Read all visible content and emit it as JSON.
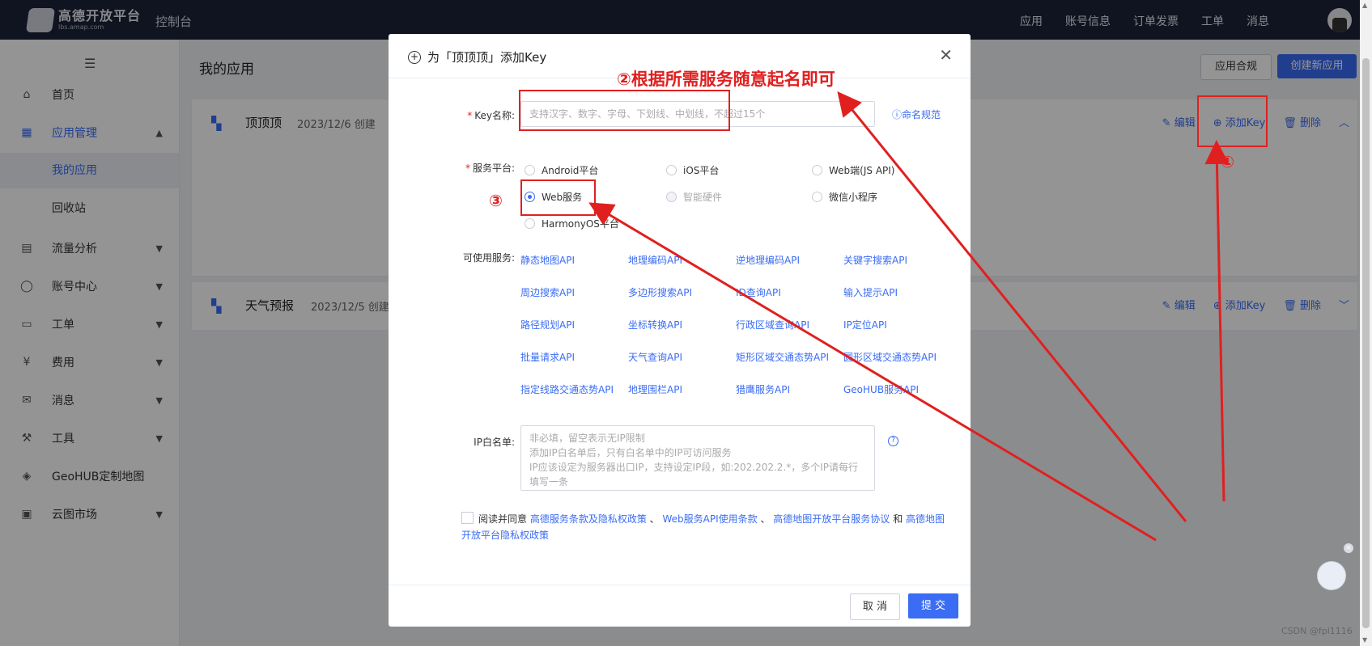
{
  "topbar": {
    "logo_main": "高德开放平台",
    "logo_sub": "lbs.amap.com",
    "console": "控制台",
    "nav": [
      "应用",
      "账号信息",
      "订单发票",
      "工单",
      "消息"
    ]
  },
  "sidebar": {
    "items": [
      {
        "label": "首页",
        "icon": "home-icon"
      },
      {
        "label": "应用管理",
        "icon": "grid-icon"
      },
      {
        "label": "我的应用"
      },
      {
        "label": "回收站"
      },
      {
        "label": "流量分析",
        "icon": "chart-icon"
      },
      {
        "label": "账号中心",
        "icon": "user-icon"
      },
      {
        "label": "工单",
        "icon": "ticket-icon"
      },
      {
        "label": "费用",
        "icon": "money-icon"
      },
      {
        "label": "消息",
        "icon": "message-icon"
      },
      {
        "label": "工具",
        "icon": "wrench-icon"
      },
      {
        "label": "GeoHUB定制地图",
        "icon": "layers-icon"
      },
      {
        "label": "云图市场",
        "icon": "store-icon"
      }
    ]
  },
  "main": {
    "title": "我的应用",
    "compliance_btn": "应用合规",
    "create_btn": "创建新应用",
    "apps": [
      {
        "name": "顶顶顶",
        "date": "2023/12/6 创建"
      },
      {
        "name": "天气预报",
        "date": "2023/12/5 创建"
      }
    ],
    "actions": {
      "edit": "编辑",
      "add_key": "添加Key",
      "delete": "删除"
    }
  },
  "modal": {
    "title": "为「顶顶顶」添加Key",
    "key_label": "Key名称:",
    "key_placeholder": "支持汉字、数字、字母、下划线、中划线，不超过15个",
    "name_rule": "命名规范",
    "platform_label": "服务平台:",
    "platforms": [
      {
        "label": "Android平台",
        "checked": false,
        "disabled": false
      },
      {
        "label": "iOS平台",
        "checked": false,
        "disabled": false
      },
      {
        "label": "Web端(JS API)",
        "checked": false,
        "disabled": false
      },
      {
        "label": "Web服务",
        "checked": true,
        "disabled": false
      },
      {
        "label": "智能硬件",
        "checked": false,
        "disabled": true
      },
      {
        "label": "微信小程序",
        "checked": false,
        "disabled": false
      },
      {
        "label": "HarmonyOS平台",
        "checked": false,
        "disabled": false
      }
    ],
    "services_label": "可使用服务:",
    "services": [
      "静态地图API",
      "地理编码API",
      "逆地理编码API",
      "关键字搜索API",
      "周边搜索API",
      "多边形搜索API",
      "ID查询API",
      "输入提示API",
      "路径规划API",
      "坐标转换API",
      "行政区域查询API",
      "IP定位API",
      "批量请求API",
      "天气查询API",
      "矩形区域交通态势API",
      "圆形区域交通态势API",
      "指定线路交通态势API",
      "地理围栏API",
      "猎鹰服务API",
      "GeoHUB服务API"
    ],
    "ip_label": "IP白名单:",
    "ip_placeholder": "非必填，留空表示无IP限制\n添加IP白名单后，只有白名单中的IP可访问服务\nIP应该设定为服务器出口IP，支持设定IP段，如:202.202.2.*，多个IP请每行填写一条",
    "agree_prefix": "阅读并同意",
    "agree_link1": "高德服务条款及隐私权政策",
    "agree_link2": "Web服务API使用条款",
    "agree_link3": "高德地图开放平台服务协议",
    "agree_and": "和",
    "agree_link4": "高德地图开放平台隐私权政策",
    "cancel": "取 消",
    "submit": "提 交"
  },
  "annotations": {
    "step1": "①",
    "step2": "②根据所需服务随意起名即可",
    "step3": "③",
    "color": "#e0201f"
  },
  "watermark": "CSDN @fpl1116"
}
